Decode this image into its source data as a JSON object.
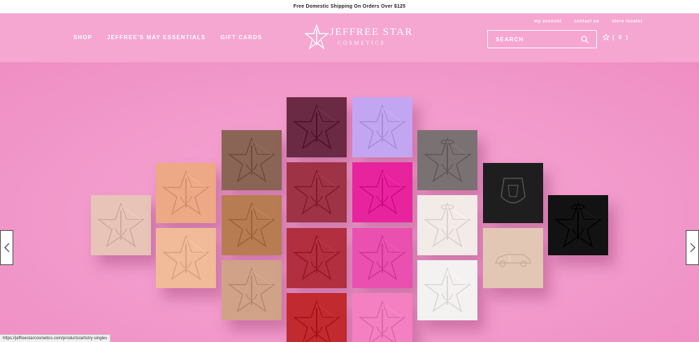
{
  "promo": {
    "text": "Free Domestic Shipping On Orders Over $125"
  },
  "nav": {
    "items": [
      {
        "label": "SHOP"
      },
      {
        "label": "JEFFREE'S MAY ESSENTIALS"
      },
      {
        "label": "GIFT CARDS"
      }
    ]
  },
  "logo": {
    "line1": "JEFFREE STAR",
    "line2": "COSMETICS"
  },
  "utility": {
    "my_account": "my account",
    "contact": "contact us",
    "store_locator": "store locator"
  },
  "search": {
    "placeholder": "SEARCH"
  },
  "cart": {
    "count_label": "( 0 )"
  },
  "status_bar": {
    "url": "https://jeffreestarcosmetics.com/products/artistry-singles"
  },
  "colors": {
    "header_pink": "#f5a6d1",
    "hero_pink": "#f29acb"
  },
  "hero": {
    "pans": [
      {
        "color": "#e8c3b8",
        "emblem": "star"
      },
      {
        "color": "#eda985",
        "emblem": "star"
      },
      {
        "color": "#f1bb9a",
        "emblem": "star"
      },
      {
        "color": "#8a6555",
        "emblem": "star"
      },
      {
        "color": "#b87c53",
        "emblem": "star"
      },
      {
        "color": "#d0a287",
        "emblem": "star"
      },
      {
        "color": "#6b2a44",
        "emblem": "star"
      },
      {
        "color": "#9e3346",
        "emblem": "star"
      },
      {
        "color": "#b12f3f",
        "emblem": "star"
      },
      {
        "color": "#c12a2e",
        "emblem": "star"
      },
      {
        "color": "#c3a6f2",
        "emblem": "star"
      },
      {
        "color": "#e8239e",
        "emblem": "star"
      },
      {
        "color": "#ea50b0",
        "emblem": "star"
      },
      {
        "color": "#f480c2",
        "emblem": "star"
      },
      {
        "color": "#7a7272",
        "emblem": "star-halo"
      },
      {
        "color": "#f3ebe7",
        "emblem": "star-halo"
      },
      {
        "color": "#f4f1f1",
        "emblem": "star"
      },
      {
        "color": "#1e1e1e",
        "emblem": "emblem"
      },
      {
        "color": "#e2c8b4",
        "emblem": "car"
      },
      {
        "color": "#121212",
        "emblem": "star-halo"
      }
    ]
  }
}
